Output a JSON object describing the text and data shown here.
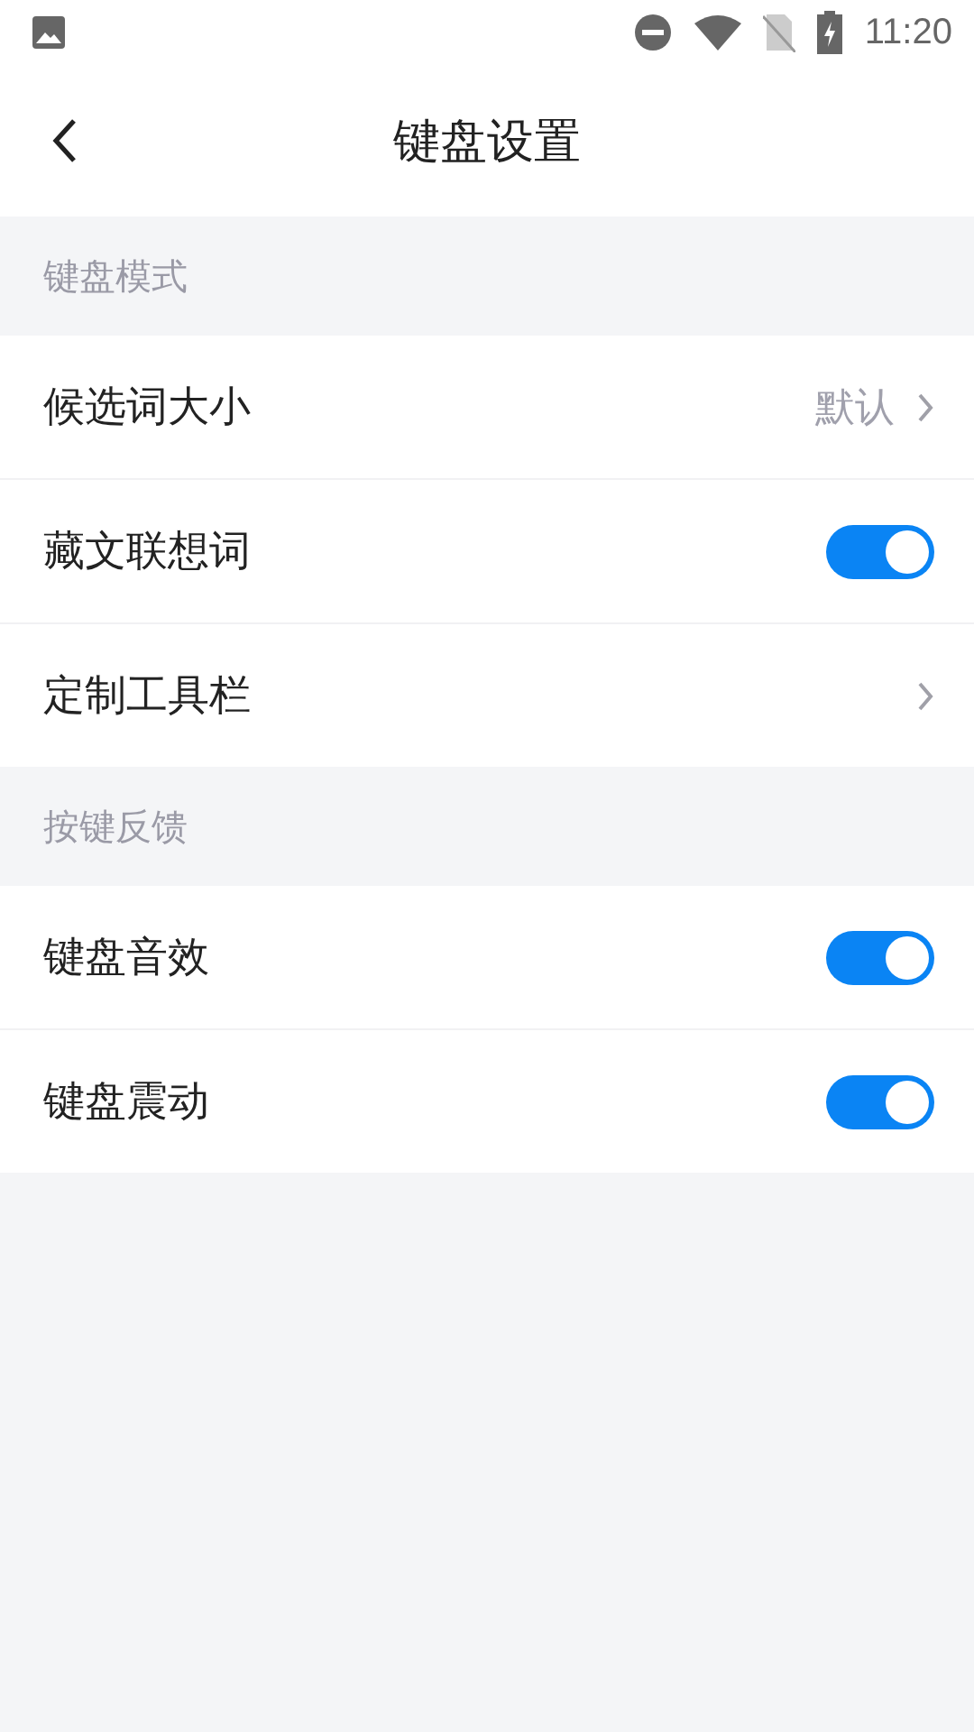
{
  "status_bar": {
    "time": "11:20"
  },
  "header": {
    "title": "键盘设置"
  },
  "sections": [
    {
      "title": "键盘模式",
      "rows": [
        {
          "kind": "value",
          "label": "候选词大小",
          "value": "默认"
        },
        {
          "kind": "toggle",
          "label": "藏文联想词",
          "on": true
        },
        {
          "kind": "link",
          "label": "定制工具栏"
        }
      ]
    },
    {
      "title": "按键反馈",
      "rows": [
        {
          "kind": "toggle",
          "label": "键盘音效",
          "on": true
        },
        {
          "kind": "toggle",
          "label": "键盘震动",
          "on": true
        }
      ]
    }
  ]
}
